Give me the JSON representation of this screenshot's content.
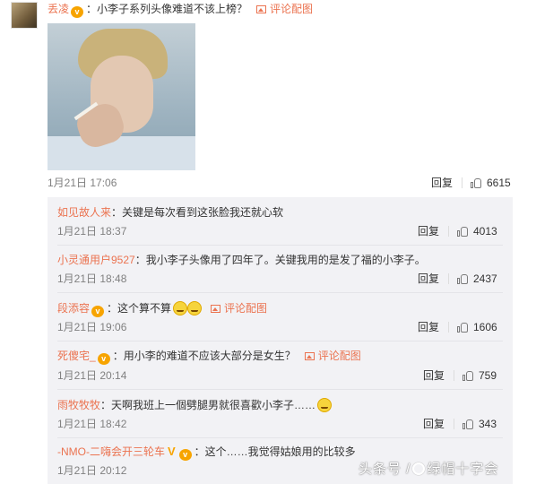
{
  "main_comment": {
    "username": "丢凌",
    "vip_mark": "v",
    "text": "：小李子系列头像难道不该上榜？",
    "comment_pic_label": "评论配图",
    "time": "1月21日 17:06",
    "reply_label": "回复",
    "likes": "6615"
  },
  "replies": [
    {
      "username": "如见故人来",
      "text": "：关键是每次看到这张脸我还就心软",
      "time": "1月21日 18:37",
      "reply_label": "回复",
      "likes": "4013"
    },
    {
      "username": "小灵通用户9527",
      "text": "：我小李子头像用了四年了。关键我用的是发了福的小李子。",
      "time": "1月21日 18:48",
      "reply_label": "回复",
      "likes": "2437"
    },
    {
      "username": "段添容",
      "vip_mark": "v",
      "text": "：这个算不算",
      "comment_pic_label": "评论配图",
      "time": "1月21日 19:06",
      "reply_label": "回复",
      "likes": "1606"
    },
    {
      "username": "死傻宅_",
      "vip_mark": "v",
      "text": "：用小李的难道不应该大部分是女生？",
      "comment_pic_label": "评论配图",
      "time": "1月21日 20:14",
      "reply_label": "回复",
      "likes": "759"
    },
    {
      "username": "雨牧牧牧",
      "text": "：天啊我班上一個劈腿男就很喜歡小李子……",
      "time": "1月21日 18:42",
      "reply_label": "回复",
      "likes": "343"
    },
    {
      "username": "-NMO-二嗨会开三轮车",
      "verified_mark": "V",
      "vip_mark": "v",
      "text": "：这个……我觉得姑娘用的比较多",
      "time": "1月21日 20:12"
    }
  ],
  "watermark": {
    "prefix": "头条号 /",
    "name": "绿帽十字会"
  },
  "colors": {
    "username": "#eb7350",
    "meta": "#808080",
    "panel": "#f2f2f5",
    "vip": "#f7a400"
  },
  "icons": {
    "like": "thumbs-up-icon",
    "comment_pic": "image-icon",
    "vip": "vip-badge-icon",
    "emoji": "laugh-cry-emoji"
  }
}
